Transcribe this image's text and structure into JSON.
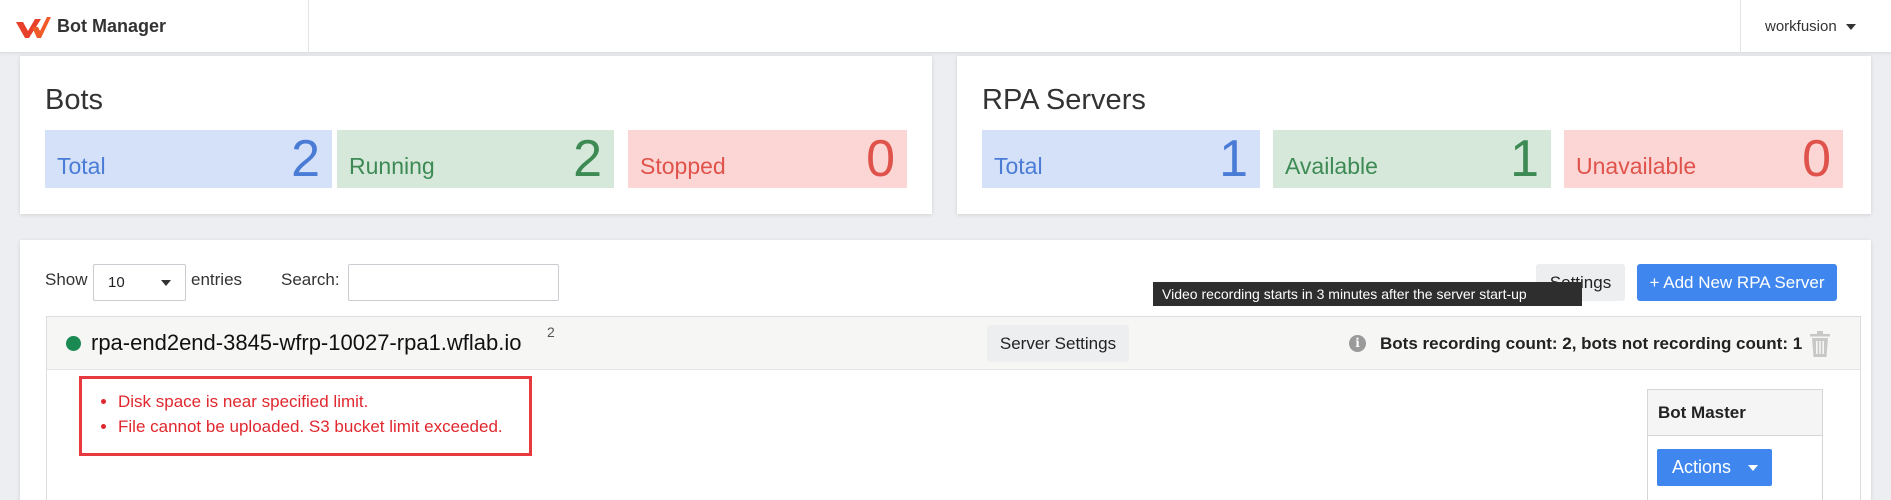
{
  "header": {
    "brand": "Bot Manager",
    "user": "workfusion"
  },
  "bots": {
    "title": "Bots",
    "tiles": [
      {
        "label": "Total",
        "value": "2"
      },
      {
        "label": "Running",
        "value": "2"
      },
      {
        "label": "Stopped",
        "value": "0"
      }
    ]
  },
  "rpa": {
    "title": "RPA Servers",
    "tiles": [
      {
        "label": "Total",
        "value": "1"
      },
      {
        "label": "Available",
        "value": "1"
      },
      {
        "label": "Unavailable",
        "value": "0"
      }
    ]
  },
  "table": {
    "show_label": "Show",
    "entries_value": "10",
    "entries_label": "entries",
    "search_label": "Search:",
    "search_value": "",
    "settings_label": "Settings",
    "add_label": "+ Add New RPA Server",
    "tooltip": "Video recording starts in 3 minutes after the server start-up"
  },
  "server": {
    "name": "rpa-end2end-3845-wfrp-10027-rpa1.wflab.io",
    "count": "2",
    "settings_label": "Server Settings",
    "info_icon": "i",
    "recording": "Bots recording count: 2, bots not recording count: 1",
    "alerts": [
      "Disk space is near specified limit.",
      "File cannot be uploaded. S3 bucket limit exceeded."
    ],
    "bot_master_label": "Bot Master",
    "actions_label": "Actions"
  },
  "colors": {
    "accent": "#3f87ef",
    "status_ok": "#1a8a52",
    "alert": "#e8393e"
  }
}
